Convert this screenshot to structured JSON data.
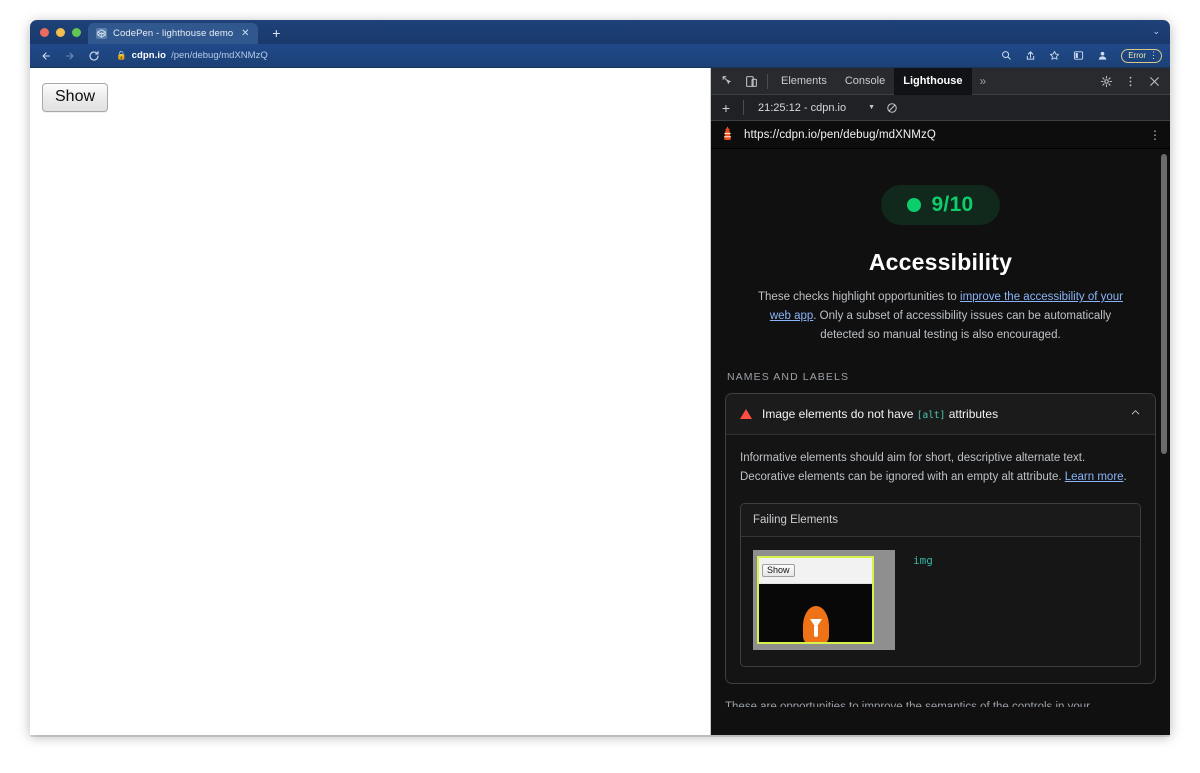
{
  "browser": {
    "tab": {
      "title": "CodePen - lighthouse demo",
      "favicon_icon": "codepen-icon",
      "close_icon": "close-icon"
    },
    "new_tab_label": "+",
    "window_caret": "⌄",
    "nav": {
      "back_icon": "arrow-left-icon",
      "forward_icon": "arrow-right-icon",
      "reload_icon": "reload-icon",
      "lock_icon": "lock-icon",
      "url_host": "cdpn.io",
      "url_path": "/pen/debug/mdXNMzQ"
    },
    "toolbar_right": {
      "search_icon": "search-icon",
      "share_icon": "share-icon",
      "bookmark_icon": "star-icon",
      "sidebar_icon": "sidebar-panel-icon",
      "profile_icon": "profile-avatar-icon",
      "error_label": "Error",
      "error_kebab": "⋮"
    }
  },
  "page": {
    "show_button_label": "Show"
  },
  "devtools": {
    "toolbar": {
      "inspect_icon": "inspect-element-icon",
      "device_icon": "device-toolbar-icon",
      "tabs": [
        {
          "label": "Elements",
          "active": false
        },
        {
          "label": "Console",
          "active": false
        },
        {
          "label": "Lighthouse",
          "active": true
        }
      ],
      "more_tabs_label": "»",
      "settings_icon": "gear-icon",
      "menu_icon": "kebab-menu-icon",
      "close_icon": "close-icon"
    },
    "subbar": {
      "new_report_label": "+",
      "run_label": "21:25:12 - cdpn.io",
      "caret": "▼",
      "clear_icon": "clear-no-entry-icon"
    }
  },
  "lighthouse": {
    "url_icon": "lighthouse-icon",
    "url": "https://cdpn.io/pen/debug/mdXNMzQ",
    "kebab": "⋮",
    "score": {
      "value": "9/10",
      "color": "#0cce6b",
      "pill_bg": "#11281c"
    },
    "category_title": "Accessibility",
    "description": {
      "before_link": "These checks highlight opportunities to ",
      "link_text": "improve the accessibility of your web app",
      "after_link": ". Only a subset of accessibility issues can be automatically detected so manual testing is also encouraged."
    },
    "group_title": "NAMES AND LABELS",
    "audit": {
      "status_icon": "fail-triangle-icon",
      "status_color": "#ff4e42",
      "title_before": "Image elements do not have ",
      "title_code": "[alt]",
      "title_after": " attributes",
      "collapse_icon": "chevron-up-icon",
      "description_before": "Informative elements should aim for short, descriptive alternate text. Decorative elements can be ignored with an empty alt attribute. ",
      "description_link": "Learn more",
      "description_after": ".",
      "failing_elements_title": "Failing Elements",
      "thumbnail": {
        "button_label": "Show",
        "highlight_color": "#d9f24a",
        "figure_icon": "flame-figure-icon"
      },
      "snippet": "img"
    },
    "next_group_preview": "These are opportunities to improve the semantics of the controls in your"
  }
}
